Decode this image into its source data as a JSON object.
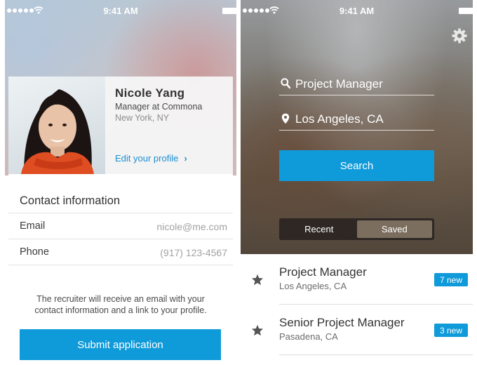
{
  "status_bar": {
    "time": "9:41 AM"
  },
  "profile": {
    "name": "Nicole Yang",
    "title": "Manager at Commona",
    "location": "New York, NY",
    "edit_link": "Edit your profile",
    "edit_chevron": "›"
  },
  "contact": {
    "heading": "Contact information",
    "rows": [
      {
        "label": "Email",
        "value": "nicole@me.com"
      },
      {
        "label": "Phone",
        "value": "(917) 123-4567"
      }
    ],
    "note": "The recruiter will receive an email with your contact information and a link to your profile.",
    "submit_label": "Submit application"
  },
  "search": {
    "keyword_value": "Project Manager",
    "location_value": "Los Angeles, CA",
    "button_label": "Search",
    "segments": [
      {
        "label": "Recent",
        "active": false
      },
      {
        "label": "Saved",
        "active": true
      }
    ]
  },
  "saved_searches": [
    {
      "title": "Project Manager",
      "location": "Los Angeles, CA",
      "badge": "7 new"
    },
    {
      "title": "Senior Project Manager",
      "location": "Pasadena, CA",
      "badge": "3 new"
    }
  ],
  "colors": {
    "accent": "#0f9ad9",
    "link": "#1a8ed1"
  },
  "icons": [
    "signal-dots-icon",
    "wifi-icon",
    "battery-icon",
    "gear-icon",
    "search-icon",
    "location-pin-icon",
    "star-icon",
    "chevron-right-icon"
  ]
}
